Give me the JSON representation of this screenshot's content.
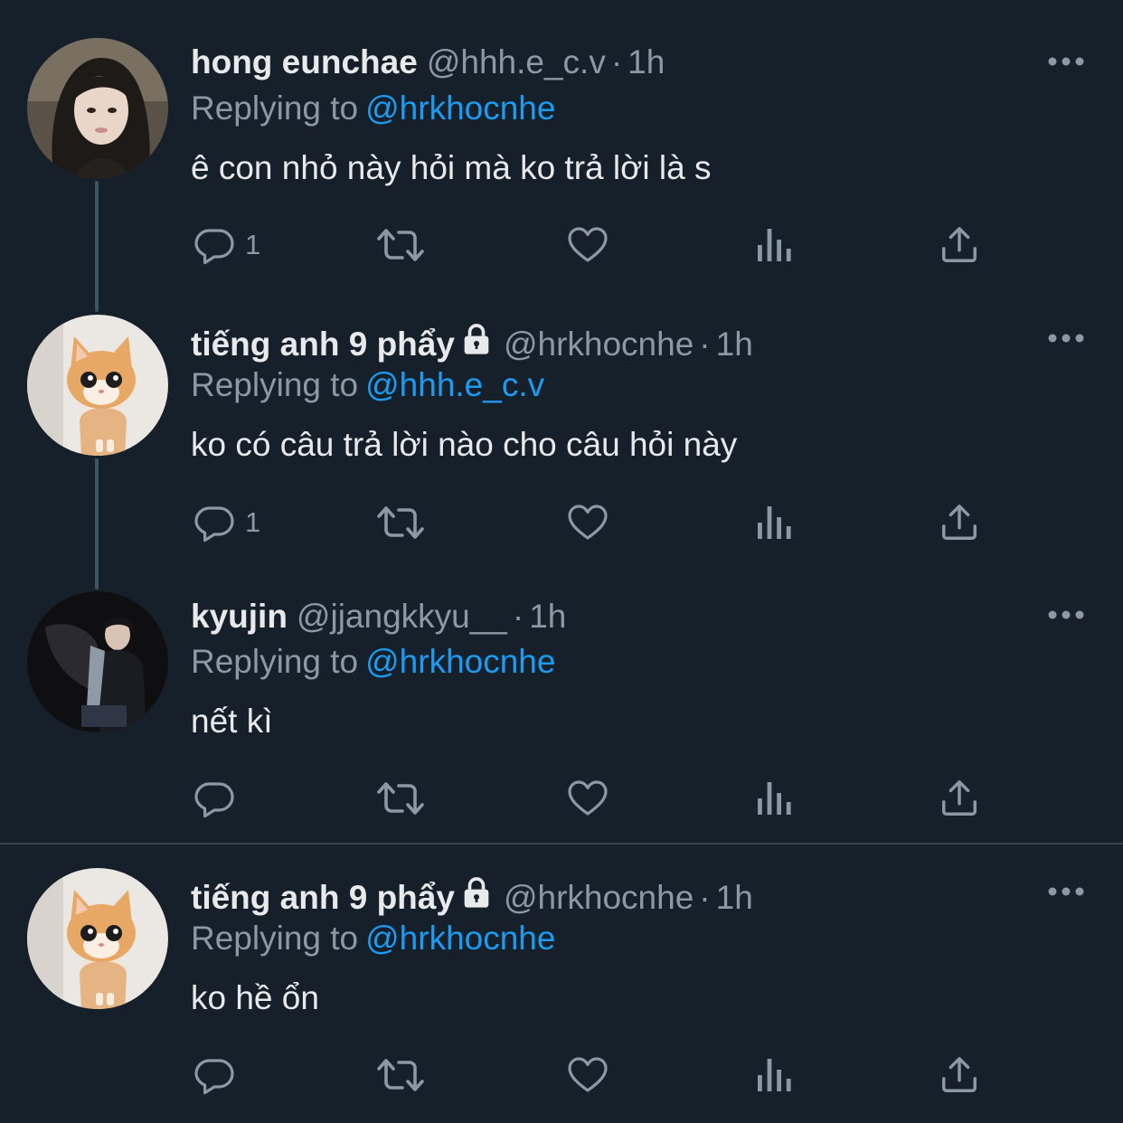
{
  "tweets": [
    {
      "display_name": "hong eunchae",
      "locked": false,
      "handle": "@hhh.e_c.v",
      "separator": "·",
      "time": "1h",
      "replying_label": "Replying to",
      "replying_to": "@hrkhocnhe",
      "text": "ê con nhỏ này hỏi mà ko trả lời là s",
      "reply_count": "1"
    },
    {
      "display_name": "tiếng anh 9 phẩy",
      "locked": true,
      "handle": "@hrkhocnhe",
      "separator": "·",
      "time": "1h",
      "replying_label": "Replying to",
      "replying_to": "@hhh.e_c.v",
      "text": "ko có câu trả lời nào cho câu hỏi này",
      "reply_count": "1"
    },
    {
      "display_name": "kyujin",
      "locked": false,
      "handle": "@jjangkkyu__",
      "separator": "·",
      "time": "1h",
      "replying_label": "Replying to",
      "replying_to": "@hrkhocnhe",
      "text": "nết kì",
      "reply_count": ""
    },
    {
      "display_name": "tiếng anh 9 phẩy",
      "locked": true,
      "handle": "@hrkhocnhe",
      "separator": "·",
      "time": "1h",
      "replying_label": "Replying to",
      "replying_to": "@hrkhocnhe",
      "text": "ko hề ổn",
      "reply_count": ""
    }
  ],
  "colors": {
    "background": "#15202b",
    "primary_text": "#e7e9ea",
    "secondary_text": "#8b98a5",
    "link": "#1d9bf0",
    "thread_line": "#3d5466"
  },
  "icons": {
    "reply": "reply-bubble-icon",
    "retweet": "retweet-icon",
    "like": "heart-icon",
    "views": "views-bar-chart-icon",
    "share": "share-upload-icon",
    "more": "more-dots-icon",
    "lock": "lock-icon"
  }
}
